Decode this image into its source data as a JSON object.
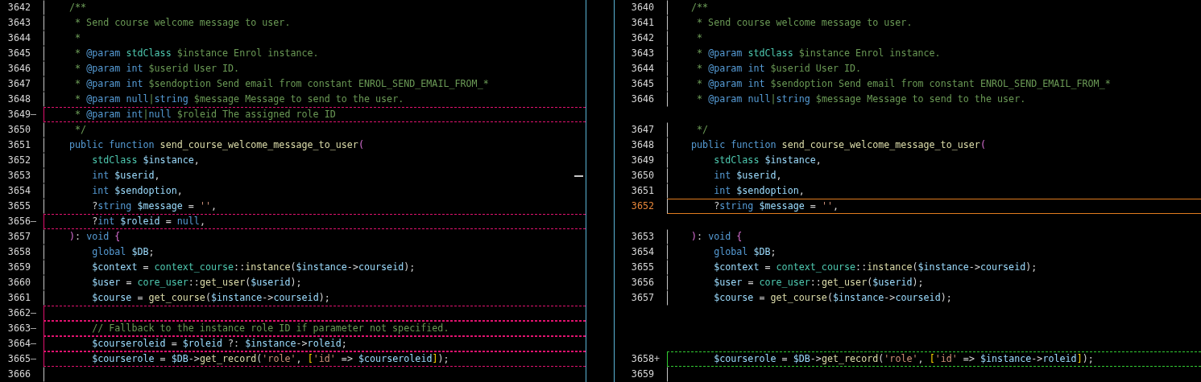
{
  "left": {
    "lines": [
      {
        "kind": "line",
        "number": "3642",
        "removed": false,
        "tokens": [
          {
            "kind": "comment",
            "t": "/**"
          }
        ]
      },
      {
        "kind": "line",
        "number": "3643",
        "removed": false,
        "tokens": [
          {
            "kind": "comment",
            "t": " * Send course welcome message to user."
          }
        ]
      },
      {
        "kind": "line",
        "number": "3644",
        "removed": false,
        "tokens": [
          {
            "kind": "comment",
            "t": " *"
          }
        ]
      },
      {
        "kind": "line",
        "number": "3645",
        "removed": false,
        "tokens": [
          {
            "kind": "comment",
            "t": " * "
          },
          {
            "kind": "keyword",
            "t": "@param "
          },
          {
            "kind": "class",
            "t": "stdClass"
          },
          {
            "kind": "comment",
            "t": " $instance Enrol instance."
          }
        ]
      },
      {
        "kind": "line",
        "number": "3646",
        "removed": false,
        "tokens": [
          {
            "kind": "comment",
            "t": " * "
          },
          {
            "kind": "keyword",
            "t": "@param int"
          },
          {
            "kind": "comment",
            "t": " $userid User ID."
          }
        ]
      },
      {
        "kind": "line",
        "number": "3647",
        "removed": false,
        "tokens": [
          {
            "kind": "comment",
            "t": " * "
          },
          {
            "kind": "keyword",
            "t": "@param int"
          },
          {
            "kind": "comment",
            "t": " $sendoption Send email from constant ENROL_SEND_EMAIL_FROM_*"
          }
        ]
      },
      {
        "kind": "line",
        "number": "3648",
        "removed": false,
        "tokens": [
          {
            "kind": "comment",
            "t": " * "
          },
          {
            "kind": "keyword",
            "t": "@param null"
          },
          {
            "kind": "comment",
            "t": "|"
          },
          {
            "kind": "keyword",
            "t": "string"
          },
          {
            "kind": "comment",
            "t": " $message Message to send to the user."
          }
        ]
      },
      {
        "kind": "line",
        "number": "3649",
        "marker": "—",
        "removed": true,
        "tokens": [
          {
            "kind": "comment",
            "t": " * "
          },
          {
            "kind": "keyword",
            "t": "@param int"
          },
          {
            "kind": "comment",
            "t": "|"
          },
          {
            "kind": "keyword",
            "t": "null"
          },
          {
            "kind": "comment",
            "t": " $roleid The assigned role ID"
          }
        ]
      },
      {
        "kind": "line",
        "number": "3650",
        "removed": false,
        "tokens": [
          {
            "kind": "comment",
            "t": " */"
          }
        ]
      },
      {
        "kind": "line",
        "number": "3651",
        "removed": false,
        "tokens": [
          {
            "kind": "keyword",
            "t": "public function "
          },
          {
            "kind": "function",
            "t": "send_course_welcome_message_to_user"
          },
          {
            "kind": "paren",
            "t": "("
          }
        ]
      },
      {
        "kind": "line",
        "number": "3652",
        "removed": false,
        "tokens": [
          {
            "kind": "class",
            "t": "    stdClass "
          },
          {
            "kind": "variable",
            "t": "$instance"
          },
          {
            "kind": "plain",
            "t": ","
          }
        ]
      },
      {
        "kind": "line",
        "number": "3653",
        "removed": false,
        "tokens": [
          {
            "kind": "keyword",
            "t": "    int "
          },
          {
            "kind": "variable",
            "t": "$userid"
          },
          {
            "kind": "plain",
            "t": ","
          }
        ]
      },
      {
        "kind": "line",
        "number": "3654",
        "removed": false,
        "tokens": [
          {
            "kind": "keyword",
            "t": "    int "
          },
          {
            "kind": "variable",
            "t": "$sendoption"
          },
          {
            "kind": "plain",
            "t": ","
          }
        ]
      },
      {
        "kind": "line",
        "number": "3655",
        "removed": false,
        "tokens": [
          {
            "kind": "plain",
            "t": "    ?"
          },
          {
            "kind": "keyword",
            "t": "string "
          },
          {
            "kind": "variable",
            "t": "$message"
          },
          {
            "kind": "plain",
            "t": " = "
          },
          {
            "kind": "string",
            "t": "''"
          },
          {
            "kind": "plain",
            "t": ","
          }
        ]
      },
      {
        "kind": "line",
        "number": "3656",
        "marker": "—",
        "removed": true,
        "tokens": [
          {
            "kind": "plain",
            "t": "    ?"
          },
          {
            "kind": "keyword",
            "t": "int "
          },
          {
            "kind": "variable",
            "t": "$roleid"
          },
          {
            "kind": "plain",
            "t": " = "
          },
          {
            "kind": "keyword",
            "t": "null"
          },
          {
            "kind": "plain",
            "t": ","
          }
        ]
      },
      {
        "kind": "line",
        "number": "3657",
        "removed": false,
        "tokens": [
          {
            "kind": "paren",
            "t": ")"
          },
          {
            "kind": "plain",
            "t": ": "
          },
          {
            "kind": "keyword",
            "t": "void "
          },
          {
            "kind": "paren",
            "t": "{"
          }
        ]
      },
      {
        "kind": "line",
        "number": "3658",
        "removed": false,
        "tokens": [
          {
            "kind": "keyword",
            "t": "    global "
          },
          {
            "kind": "variable",
            "t": "$DB"
          },
          {
            "kind": "plain",
            "t": ";"
          }
        ]
      },
      {
        "kind": "line",
        "number": "3659",
        "removed": false,
        "tokens": [
          {
            "kind": "variable",
            "t": "    $context"
          },
          {
            "kind": "plain",
            "t": " = "
          },
          {
            "kind": "class",
            "t": "context_course"
          },
          {
            "kind": "plain",
            "t": "::"
          },
          {
            "kind": "function",
            "t": "instance"
          },
          {
            "kind": "plain",
            "t": "("
          },
          {
            "kind": "variable",
            "t": "$instance"
          },
          {
            "kind": "plain",
            "t": "->"
          },
          {
            "kind": "variable",
            "t": "courseid"
          },
          {
            "kind": "plain",
            "t": ");"
          }
        ]
      },
      {
        "kind": "line",
        "number": "3660",
        "removed": false,
        "tokens": [
          {
            "kind": "variable",
            "t": "    $user"
          },
          {
            "kind": "plain",
            "t": " = "
          },
          {
            "kind": "class",
            "t": "core_user"
          },
          {
            "kind": "plain",
            "t": "::"
          },
          {
            "kind": "function",
            "t": "get_user"
          },
          {
            "kind": "plain",
            "t": "("
          },
          {
            "kind": "variable",
            "t": "$userid"
          },
          {
            "kind": "plain",
            "t": ");"
          }
        ]
      },
      {
        "kind": "line",
        "number": "3661",
        "removed": false,
        "tokens": [
          {
            "kind": "variable",
            "t": "    $course"
          },
          {
            "kind": "plain",
            "t": " = "
          },
          {
            "kind": "function",
            "t": "get_course"
          },
          {
            "kind": "plain",
            "t": "("
          },
          {
            "kind": "variable",
            "t": "$instance"
          },
          {
            "kind": "plain",
            "t": "->"
          },
          {
            "kind": "variable",
            "t": "courseid"
          },
          {
            "kind": "plain",
            "t": ");"
          }
        ]
      },
      {
        "kind": "line",
        "number": "3662",
        "marker": "—",
        "removed": true
      },
      {
        "kind": "line",
        "number": "3663",
        "marker": "—",
        "removed": true,
        "tokens": [
          {
            "kind": "comment",
            "t": "    // Fallback to the instance role ID if parameter not specified."
          }
        ]
      },
      {
        "kind": "line",
        "number": "3664",
        "marker": "—",
        "removed": true,
        "tokens": [
          {
            "kind": "variable",
            "t": "    $courseroleid"
          },
          {
            "kind": "plain",
            "t": " = "
          },
          {
            "kind": "variable",
            "t": "$roleid"
          },
          {
            "kind": "plain",
            "t": " ?: "
          },
          {
            "kind": "variable",
            "t": "$instance"
          },
          {
            "kind": "plain",
            "t": "->"
          },
          {
            "kind": "variable",
            "t": "roleid"
          },
          {
            "kind": "plain",
            "t": ";"
          }
        ]
      },
      {
        "kind": "line",
        "number": "3665",
        "marker": "—",
        "removed": true,
        "tokens": [
          {
            "kind": "variable",
            "t": "    $courserole"
          },
          {
            "kind": "plain",
            "t": " = "
          },
          {
            "kind": "variable",
            "t": "$DB"
          },
          {
            "kind": "plain",
            "t": "->"
          },
          {
            "kind": "function",
            "t": "get_record"
          },
          {
            "kind": "plain",
            "t": "("
          },
          {
            "kind": "string",
            "t": "'role'"
          },
          {
            "kind": "plain",
            "t": ", "
          },
          {
            "kind": "square",
            "t": "["
          },
          {
            "kind": "string",
            "t": "'id'"
          },
          {
            "kind": "plain",
            "t": " => "
          },
          {
            "kind": "variable",
            "t": "$courseroleid"
          },
          {
            "kind": "square",
            "t": "]"
          },
          {
            "kind": "plain",
            "t": ");"
          }
        ]
      },
      {
        "kind": "line",
        "number": "3666",
        "removed": false
      }
    ]
  },
  "right": {
    "lines": [
      {
        "kind": "line",
        "number": "3640",
        "added": false,
        "current": false,
        "tokens": [
          {
            "kind": "comment",
            "t": "/**"
          }
        ]
      },
      {
        "kind": "line",
        "number": "3641",
        "added": false,
        "current": false,
        "tokens": [
          {
            "kind": "comment",
            "t": " * Send course welcome message to user."
          }
        ]
      },
      {
        "kind": "line",
        "number": "3642",
        "added": false,
        "current": false,
        "tokens": [
          {
            "kind": "comment",
            "t": " *"
          }
        ]
      },
      {
        "kind": "line",
        "number": "3643",
        "added": false,
        "current": false,
        "tokens": [
          {
            "kind": "comment",
            "t": " * "
          },
          {
            "kind": "keyword",
            "t": "@param "
          },
          {
            "kind": "class",
            "t": "stdClass"
          },
          {
            "kind": "comment",
            "t": " $instance Enrol instance."
          }
        ]
      },
      {
        "kind": "line",
        "number": "3644",
        "added": false,
        "current": false,
        "tokens": [
          {
            "kind": "comment",
            "t": " * "
          },
          {
            "kind": "keyword",
            "t": "@param int"
          },
          {
            "kind": "comment",
            "t": " $userid User ID."
          }
        ]
      },
      {
        "kind": "line",
        "number": "3645",
        "added": false,
        "current": false,
        "tokens": [
          {
            "kind": "comment",
            "t": " * "
          },
          {
            "kind": "keyword",
            "t": "@param int"
          },
          {
            "kind": "comment",
            "t": " $sendoption Send email from constant ENROL_SEND_EMAIL_FROM_*"
          }
        ]
      },
      {
        "kind": "line",
        "number": "3646",
        "added": false,
        "current": false,
        "tokens": [
          {
            "kind": "comment",
            "t": " * "
          },
          {
            "kind": "keyword",
            "t": "@param null"
          },
          {
            "kind": "comment",
            "t": "|"
          },
          {
            "kind": "keyword",
            "t": "string"
          },
          {
            "kind": "comment",
            "t": " $message Message to send to the user."
          }
        ]
      },
      {
        "kind": "filler"
      },
      {
        "kind": "line",
        "number": "3647",
        "added": false,
        "current": false,
        "tokens": [
          {
            "kind": "comment",
            "t": " */"
          }
        ]
      },
      {
        "kind": "line",
        "number": "3648",
        "added": false,
        "current": false,
        "tokens": [
          {
            "kind": "keyword",
            "t": "public function "
          },
          {
            "kind": "function",
            "t": "send_course_welcome_message_to_user"
          },
          {
            "kind": "paren",
            "t": "("
          }
        ]
      },
      {
        "kind": "line",
        "number": "3649",
        "added": false,
        "current": false,
        "tokens": [
          {
            "kind": "class",
            "t": "    stdClass "
          },
          {
            "kind": "variable",
            "t": "$instance"
          },
          {
            "kind": "plain",
            "t": ","
          }
        ]
      },
      {
        "kind": "line",
        "number": "3650",
        "added": false,
        "current": false,
        "tokens": [
          {
            "kind": "keyword",
            "t": "    int "
          },
          {
            "kind": "variable",
            "t": "$userid"
          },
          {
            "kind": "plain",
            "t": ","
          }
        ]
      },
      {
        "kind": "line",
        "number": "3651",
        "added": false,
        "current": false,
        "tokens": [
          {
            "kind": "keyword",
            "t": "    int "
          },
          {
            "kind": "variable",
            "t": "$sendoption"
          },
          {
            "kind": "plain",
            "t": ","
          }
        ]
      },
      {
        "kind": "line",
        "number": "3652",
        "added": false,
        "current": true,
        "tokens": [
          {
            "kind": "plain",
            "t": "    ?"
          },
          {
            "kind": "keyword",
            "t": "string "
          },
          {
            "kind": "variable",
            "t": "$message"
          },
          {
            "kind": "plain",
            "t": " = "
          },
          {
            "kind": "string",
            "t": "''"
          },
          {
            "kind": "plain",
            "t": ","
          }
        ]
      },
      {
        "kind": "filler"
      },
      {
        "kind": "line",
        "number": "3653",
        "added": false,
        "current": false,
        "tokens": [
          {
            "kind": "paren",
            "t": ")"
          },
          {
            "kind": "plain",
            "t": ": "
          },
          {
            "kind": "keyword",
            "t": "void "
          },
          {
            "kind": "paren",
            "t": "{"
          }
        ]
      },
      {
        "kind": "line",
        "number": "3654",
        "added": false,
        "current": false,
        "tokens": [
          {
            "kind": "keyword",
            "t": "    global "
          },
          {
            "kind": "variable",
            "t": "$DB"
          },
          {
            "kind": "plain",
            "t": ";"
          }
        ]
      },
      {
        "kind": "line",
        "number": "3655",
        "added": false,
        "current": false,
        "tokens": [
          {
            "kind": "variable",
            "t": "    $context"
          },
          {
            "kind": "plain",
            "t": " = "
          },
          {
            "kind": "class",
            "t": "context_course"
          },
          {
            "kind": "plain",
            "t": "::"
          },
          {
            "kind": "function",
            "t": "instance"
          },
          {
            "kind": "plain",
            "t": "("
          },
          {
            "kind": "variable",
            "t": "$instance"
          },
          {
            "kind": "plain",
            "t": "->"
          },
          {
            "kind": "variable",
            "t": "courseid"
          },
          {
            "kind": "plain",
            "t": ");"
          }
        ]
      },
      {
        "kind": "line",
        "number": "3656",
        "added": false,
        "current": false,
        "tokens": [
          {
            "kind": "variable",
            "t": "    $user"
          },
          {
            "kind": "plain",
            "t": " = "
          },
          {
            "kind": "class",
            "t": "core_user"
          },
          {
            "kind": "plain",
            "t": "::"
          },
          {
            "kind": "function",
            "t": "get_user"
          },
          {
            "kind": "plain",
            "t": "("
          },
          {
            "kind": "variable",
            "t": "$userid"
          },
          {
            "kind": "plain",
            "t": ");"
          }
        ]
      },
      {
        "kind": "line",
        "number": "3657",
        "added": false,
        "current": false,
        "tokens": [
          {
            "kind": "variable",
            "t": "    $course"
          },
          {
            "kind": "plain",
            "t": " = "
          },
          {
            "kind": "function",
            "t": "get_course"
          },
          {
            "kind": "plain",
            "t": "("
          },
          {
            "kind": "variable",
            "t": "$instance"
          },
          {
            "kind": "plain",
            "t": "->"
          },
          {
            "kind": "variable",
            "t": "courseid"
          },
          {
            "kind": "plain",
            "t": ");"
          }
        ]
      },
      {
        "kind": "filler"
      },
      {
        "kind": "filler"
      },
      {
        "kind": "filler"
      },
      {
        "kind": "line",
        "number": "3658",
        "marker": "+",
        "added": true,
        "current": false,
        "tokens": [
          {
            "kind": "variable",
            "t": "    $courserole"
          },
          {
            "kind": "plain",
            "t": " = "
          },
          {
            "kind": "variable",
            "t": "$DB"
          },
          {
            "kind": "plain",
            "t": "->"
          },
          {
            "kind": "function",
            "t": "get_record"
          },
          {
            "kind": "plain",
            "t": "("
          },
          {
            "kind": "string",
            "t": "'role'"
          },
          {
            "kind": "plain",
            "t": ", "
          },
          {
            "kind": "square",
            "t": "["
          },
          {
            "kind": "string",
            "t": "'id'"
          },
          {
            "kind": "plain",
            "t": " => "
          },
          {
            "kind": "variable",
            "t": "$instance"
          },
          {
            "kind": "plain",
            "t": "->"
          },
          {
            "kind": "variable",
            "t": "roleid"
          },
          {
            "kind": "square",
            "t": "]"
          },
          {
            "kind": "plain",
            "t": ");"
          }
        ]
      },
      {
        "kind": "line",
        "number": "3659",
        "added": false,
        "current": false
      }
    ]
  }
}
